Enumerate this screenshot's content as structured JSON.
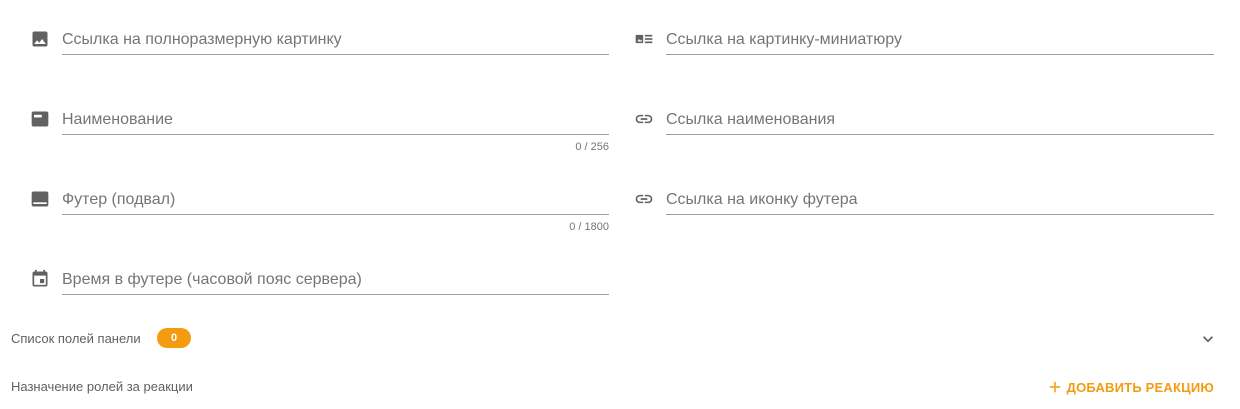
{
  "fields": {
    "full_image": {
      "placeholder": "Ссылка на полноразмерную картинку",
      "icon": "image-icon"
    },
    "thumbnail": {
      "placeholder": "Ссылка на картинку-миниатюру",
      "icon": "thumbnail-icon"
    },
    "title": {
      "placeholder": "Наименование",
      "counter": "0 / 256",
      "icon": "title-icon"
    },
    "title_url": {
      "placeholder": "Ссылка наименования",
      "icon": "link-icon"
    },
    "footer": {
      "placeholder": "Футер (подвал)",
      "counter": "0 / 1800",
      "icon": "footer-icon"
    },
    "footer_icon_url": {
      "placeholder": "Ссылка на иконку футера",
      "icon": "link-icon"
    },
    "footer_time": {
      "placeholder": "Время в футере (часовой пояс сервера)",
      "icon": "calendar-icon"
    }
  },
  "panel_fields": {
    "label": "Список полей панели",
    "count": "0"
  },
  "reaction_roles": {
    "label": "Назначение ролей за реакции",
    "add_button": "ДОБАВИТЬ РЕАКЦИЮ"
  },
  "colors": {
    "accent": "#f39c12",
    "icon": "#616161",
    "underline": "#9e9e9e"
  }
}
